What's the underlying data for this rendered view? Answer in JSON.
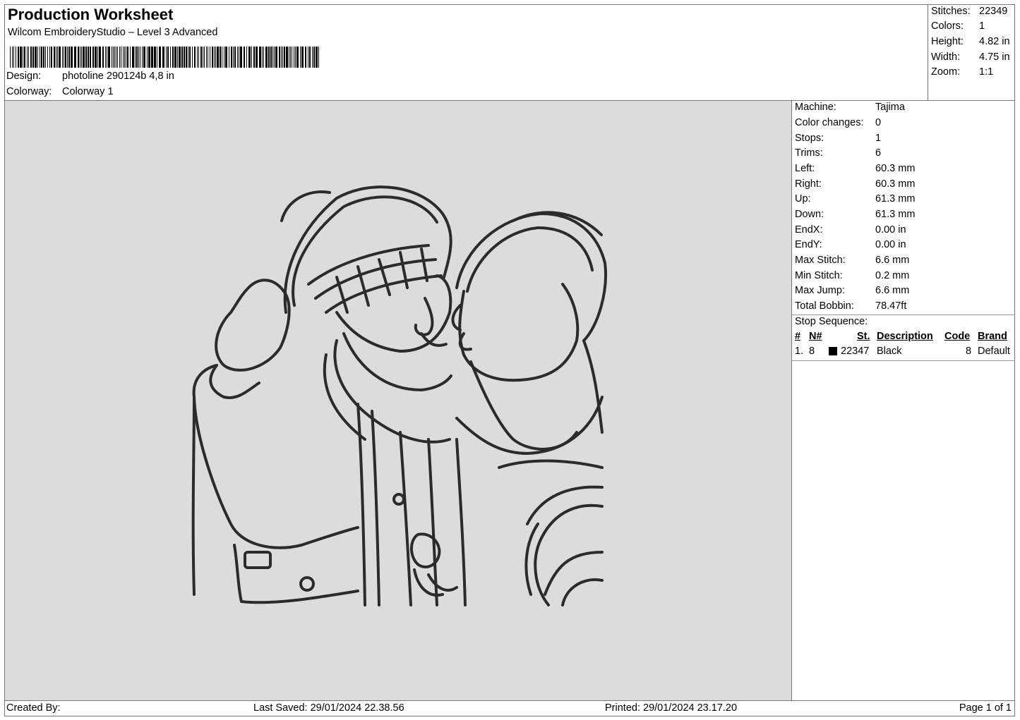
{
  "header": {
    "title": "Production Worksheet",
    "software": "Wilcom EmbroideryStudio – Level 3 Advanced",
    "design_label": "Design:",
    "design_value": "photoline 290124b 4,8 in",
    "colorway_label": "Colorway:",
    "colorway_value": "Colorway 1"
  },
  "summary": {
    "stitches_label": "Stitches:",
    "stitches": "22349",
    "colors_label": "Colors:",
    "colors": "1",
    "height_label": "Height:",
    "height": "4.82 in",
    "width_label": "Width:",
    "width": "4.75 in",
    "zoom_label": "Zoom:",
    "zoom": "1:1"
  },
  "machine_info": [
    {
      "label": "Machine:",
      "value": "Tajima"
    },
    {
      "label": "Color changes:",
      "value": "0"
    },
    {
      "label": "Stops:",
      "value": "1"
    },
    {
      "label": "Trims:",
      "value": "6"
    },
    {
      "label": "Left:",
      "value": "60.3 mm"
    },
    {
      "label": "Right:",
      "value": "60.3 mm"
    },
    {
      "label": "Up:",
      "value": "61.3 mm"
    },
    {
      "label": "Down:",
      "value": "61.3 mm"
    },
    {
      "label": "EndX:",
      "value": "0.00 in"
    },
    {
      "label": "EndY:",
      "value": "0.00 in"
    },
    {
      "label": "Max Stitch:",
      "value": "6.6 mm"
    },
    {
      "label": "Min Stitch:",
      "value": "0.2 mm"
    },
    {
      "label": "Max Jump:",
      "value": "6.6 mm"
    },
    {
      "label": "Total Bobbin:",
      "value": "78.47ft"
    }
  ],
  "stop_sequence": {
    "title": "Stop Sequence:",
    "headers": {
      "num": "#",
      "n": "N#",
      "st": "St.",
      "description": "Description",
      "code": "Code",
      "brand": "Brand"
    },
    "rows": [
      {
        "num": "1.",
        "n": "8",
        "color": "#000000",
        "st": "22347",
        "description": "Black",
        "code": "8",
        "brand": "Default"
      }
    ]
  },
  "footer": {
    "created_by": "Created By:",
    "last_saved": "Last Saved: 29/01/2024 22.38.56",
    "printed": "Printed: 29/01/2024 23.17.20",
    "page": "Page 1 of 1"
  },
  "design_preview": {
    "description": "",
    "thread_color": "#2b2b2b",
    "background": "#dcdcdc"
  }
}
